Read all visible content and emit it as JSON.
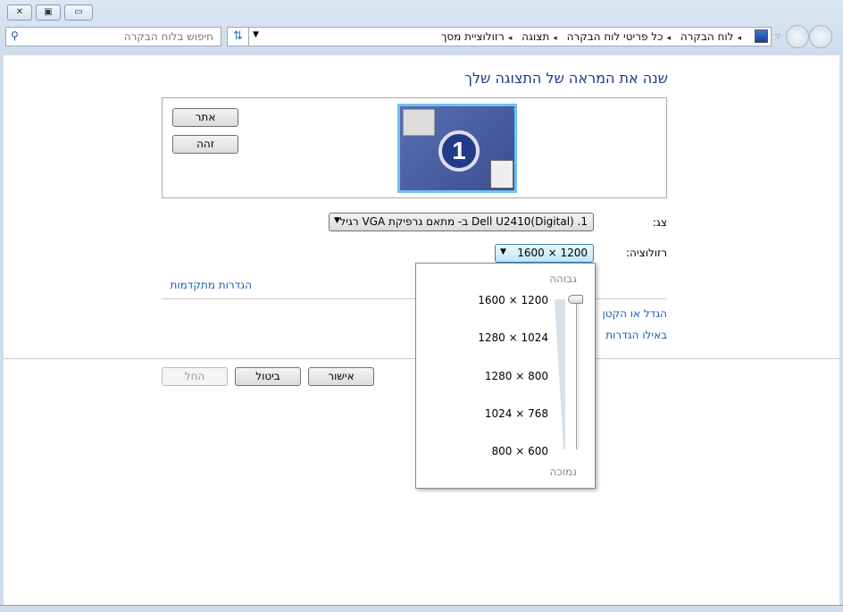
{
  "window": {
    "close_icon": "close-icon",
    "restore_icon": "restore-icon",
    "minimize_icon": "minimize-icon"
  },
  "search": {
    "placeholder": "חיפוש בלוח הבקרה"
  },
  "breadcrumb": [
    "לוח הבקרה",
    "כל פריטי לוח הבקרה",
    "תצוגה",
    "רזולוציית מסך"
  ],
  "page_title": "שנה את המראה של התצוגה שלך",
  "buttons": {
    "detect": "אתר",
    "identify": "זהה",
    "ok": "אישור",
    "cancel": "ביטול",
    "apply": "החל"
  },
  "monitor": {
    "number": "1"
  },
  "display": {
    "label": "צג:",
    "value": "1. Dell U2410(Digital) ב- מתאם גרפיקת VGA רגיל"
  },
  "resolution": {
    "label": "רזולוציה:",
    "value": "1600 × 1200",
    "high_label": "גבוהה",
    "low_label": "נמוכה",
    "options": [
      "1600 × 1200",
      "1280 × 1024",
      "1280 × 800",
      "1024 × 768",
      "800 × 600"
    ],
    "slider_selected": "1600 × 1200"
  },
  "links": {
    "advanced": "הגדרות מתקדמות",
    "resize": "הגדל או הקטן",
    "which": "באילו הגדרות"
  }
}
